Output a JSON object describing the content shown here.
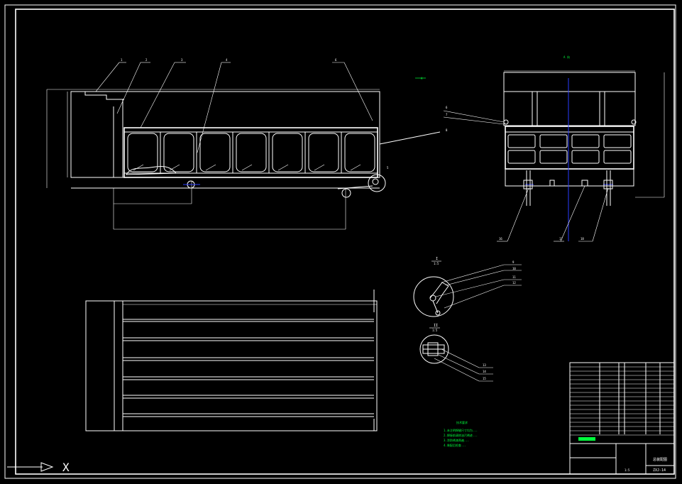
{
  "view_labels": {
    "side_view": "A 向",
    "section_mark": "A",
    "detail_1": "I",
    "detail_1_scale": "1:5",
    "detail_2": "II",
    "detail_2_scale": "1:5"
  },
  "balloons_front": [
    "1",
    "2",
    "3",
    "4",
    "5",
    "6"
  ],
  "balloons_side": [
    "6",
    "7",
    "8",
    "16",
    "17",
    "18"
  ],
  "balloons_detail": [
    "9",
    "10",
    "11",
    "12",
    "13",
    "14",
    "15"
  ],
  "tech_requirements": {
    "title": "技术要求",
    "items": [
      "1.未注明焊缝尺寸均为...",
      "2.焊接前清除油污锈迹...",
      "3.涂防锈漆两遍...",
      "4.装配后检查..."
    ]
  },
  "title_block": {
    "drawing_name": "总装配图",
    "drawing_number": "ZXJ-14",
    "scale_label": "1:5",
    "colors": {
      "line": "#ffffff",
      "accent": "#00ff3c",
      "axis": "#2a3cff"
    }
  },
  "ucs": {
    "axis_label": "X"
  }
}
